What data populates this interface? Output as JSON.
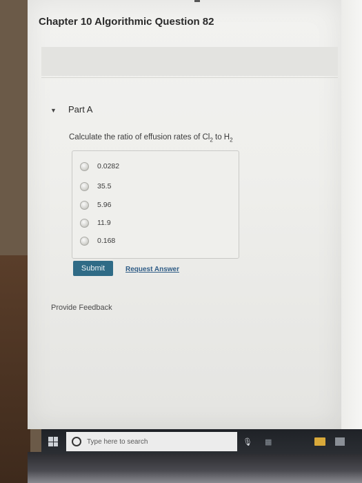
{
  "page": {
    "chapter_title": "Chapter 10 Algorithmic Question 82"
  },
  "part": {
    "caret_icon": "triangle-down-icon",
    "title": "Part A"
  },
  "question": {
    "prefix": "Calculate the ratio of effusion rates of Cl",
    "sub1": "2",
    "middle": " to H",
    "sub2": "2"
  },
  "options": [
    {
      "label": "0.0282"
    },
    {
      "label": "35.5"
    },
    {
      "label": "5.96"
    },
    {
      "label": "11.9"
    },
    {
      "label": "0.168"
    }
  ],
  "actions": {
    "submit_label": "Submit",
    "request_answer_label": "Request Answer",
    "feedback_label": "Provide Feedback"
  },
  "taskbar": {
    "search_placeholder": "Type here to search",
    "icons": [
      "windows-start-icon",
      "cortana-icon",
      "microphone-icon",
      "task-view-icon",
      "file-explorer-icon",
      "store-icon"
    ]
  }
}
